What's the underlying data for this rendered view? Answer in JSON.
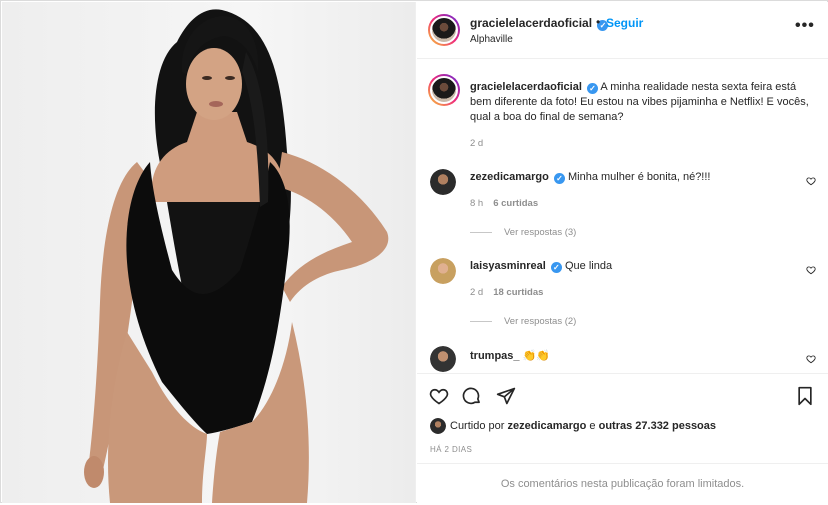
{
  "post": {
    "username": "gracielelacerdaoficial",
    "verified": true,
    "follow_label": "Seguir",
    "location": "Alphaville",
    "more_label": "•••",
    "caption": "A minha realidade nesta sexta feira está bem diferente da foto! Eu estou na vibes pijaminha e Netflix! E vocês, qual a boa do final de semana?",
    "caption_age": "2 d"
  },
  "comments": [
    {
      "username": "zezedicamargo",
      "verified": true,
      "text": "Minha mulher é bonita, né?!!!",
      "age": "8 h",
      "likes": "6 curtidas",
      "replies": "Ver respostas (3)"
    },
    {
      "username": "laisyasminreal",
      "verified": true,
      "text": "Que linda",
      "age": "2 d",
      "likes": "18 curtidas",
      "replies": "Ver respostas (2)"
    },
    {
      "username": "trumpas_",
      "verified": false,
      "text": "👏👏"
    }
  ],
  "footer": {
    "liked_prefix": "Curtido por",
    "liked_user": "zezedicamargo",
    "liked_and": "e",
    "liked_others": "outras 27.332 pessoas",
    "time_ago": "HÁ 2 DIAS",
    "limited_notice": "Os comentários nesta publicação foram limitados."
  },
  "icons": {
    "like": "heart-icon",
    "comment": "comment-icon",
    "share": "paper-plane-icon",
    "save": "bookmark-icon",
    "verified": "verified-badge-icon"
  },
  "colors": {
    "accent": "#0095f6",
    "verified": "#3897f0",
    "muted": "#8e8e8e",
    "text": "#262626"
  }
}
